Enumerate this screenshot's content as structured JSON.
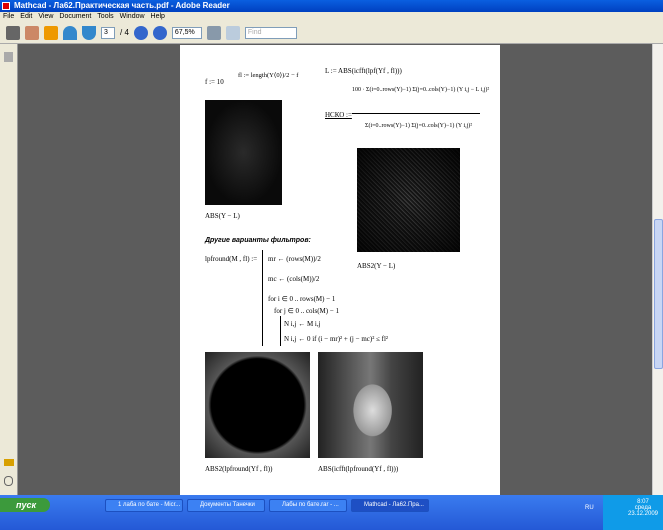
{
  "window": {
    "title": "Mathcad - Ла62.Практическая часть.pdf - Adobe Reader"
  },
  "menu": [
    "File",
    "Edit",
    "View",
    "Document",
    "Tools",
    "Window",
    "Help"
  ],
  "toolbar": {
    "page_current": "3",
    "page_total": "/ 4",
    "zoom": "67,5%",
    "find_placeholder": "Find"
  },
  "doc": {
    "f_def": "f := 10",
    "fl_def": "fl := length(Y⟨0⟩)/2 − f",
    "L_def": "L := ABS(icfft(lpf(Yf , fl)))",
    "ncko_label": "НСКО :=",
    "ncko_num": "100 · Σ(i=0..rows(Y)−1) Σ(j=0..cols(Y)−1) (Y i,j − L i,j)²",
    "ncko_den": "Σ(i=0..rows(Y)−1) Σ(j=0..cols(Y)−1) (Y i,j)²",
    "caption1": "ABS(Y − L)",
    "caption2": "ABS2(Y − L)",
    "section_heading": "Другие варианты фильтров:",
    "lpfround_def": "lpfround(M , fl) :=",
    "prog": [
      "mr ← (rows(M))/2",
      "mc ← (cols(M))/2",
      "for  i ∈ 0 .. rows(M) − 1",
      "for  j ∈ 0 .. cols(M) − 1",
      "N i,j ← M i,j",
      "N i,j ← 0  if  (i − mr)² + (j − mc)² ≤ fl²"
    ],
    "caption3": "ABS2(lpfround(Yf , fl))",
    "caption4": "ABS(icfft(lpfround(Yf , fl)))"
  },
  "taskbar": {
    "start": "пуск",
    "tasks": [
      "1 лаба по бате - Micr...",
      "Документы Танечки",
      "Лабы по бате.rar - ...",
      "Mathcad - Ла62.Пра..."
    ],
    "lang": "RU",
    "time": "8:07",
    "day": "среда",
    "date": "23.12.2009"
  }
}
